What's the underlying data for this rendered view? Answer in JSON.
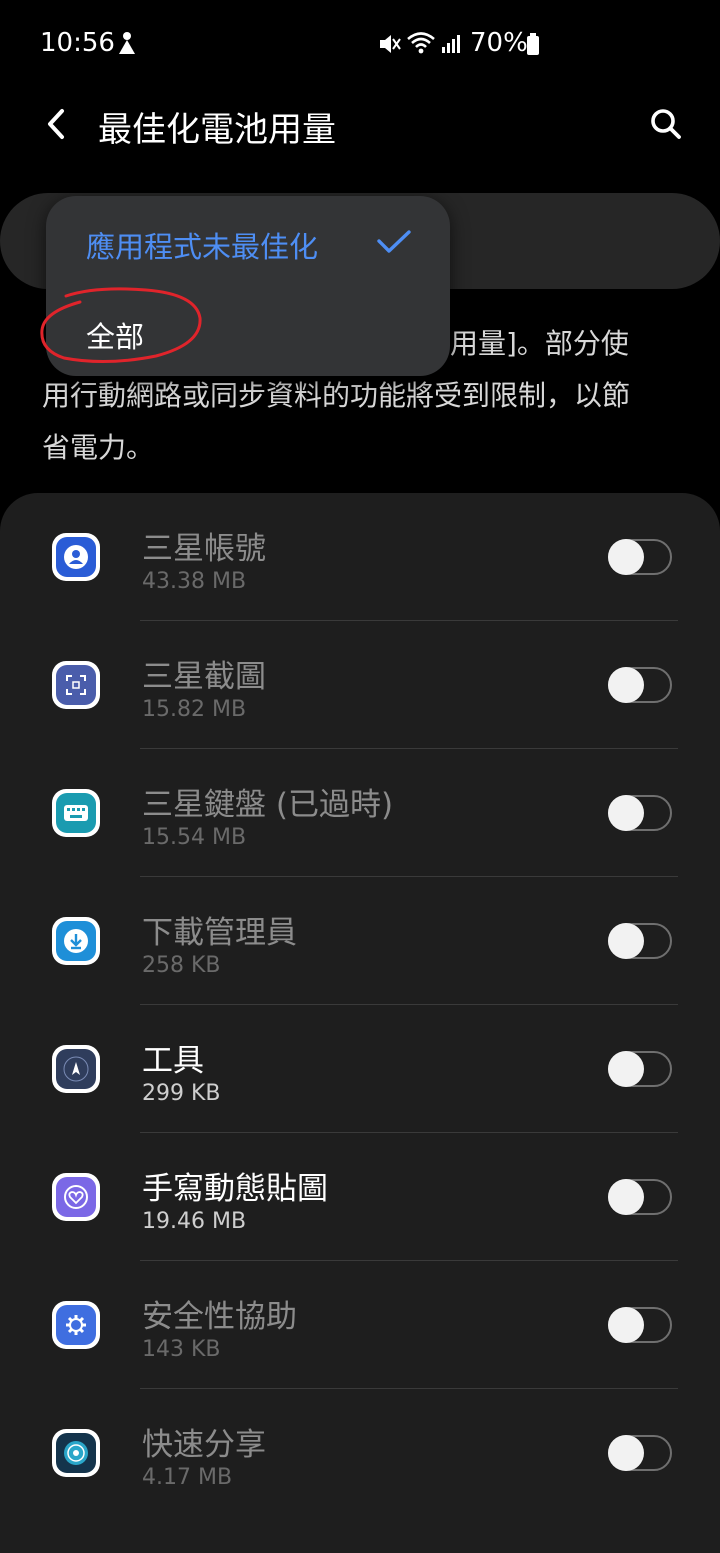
{
  "status_bar": {
    "time": "10:56",
    "battery_text": "70%"
  },
  "header": {
    "title": "最佳化電池用量"
  },
  "dropdown": {
    "options": [
      {
        "label": "應用程式未最佳化",
        "selected": true
      },
      {
        "label": "全部",
        "selected": false
      }
    ]
  },
  "description": {
    "visible_text_line1": "池用量]。部分使",
    "visible_text_line2": "用行動網路或同步資料的功能將受到限制，以節",
    "visible_text_line3": "省電力。"
  },
  "apps": [
    {
      "name": "三星帳號",
      "size": "43.38 MB",
      "icon": "samsung-account-icon",
      "enabled": false,
      "dimmed": true
    },
    {
      "name": "三星截圖",
      "size": "15.82 MB",
      "icon": "samsung-capture-icon",
      "enabled": false,
      "dimmed": true
    },
    {
      "name": "三星鍵盤 (已過時)",
      "size": "15.54 MB",
      "icon": "samsung-keyboard-icon",
      "enabled": false,
      "dimmed": true
    },
    {
      "name": "下載管理員",
      "size": "258 KB",
      "icon": "download-manager-icon",
      "enabled": false,
      "dimmed": true
    },
    {
      "name": "工具",
      "size": "299 KB",
      "icon": "compass-tools-icon",
      "enabled": false,
      "dimmed": false
    },
    {
      "name": "手寫動態貼圖",
      "size": "19.46 MB",
      "icon": "live-message-icon",
      "enabled": false,
      "dimmed": false
    },
    {
      "name": "安全性協助",
      "size": "143 KB",
      "icon": "security-assist-icon",
      "enabled": false,
      "dimmed": true
    },
    {
      "name": "快速分享",
      "size": "4.17 MB",
      "icon": "quick-share-icon",
      "enabled": false,
      "dimmed": true
    }
  ],
  "colors": {
    "accent": "#4e8ef4",
    "background": "#000000",
    "list_background": "#1e1e1e",
    "annotation": "#e0242b"
  }
}
